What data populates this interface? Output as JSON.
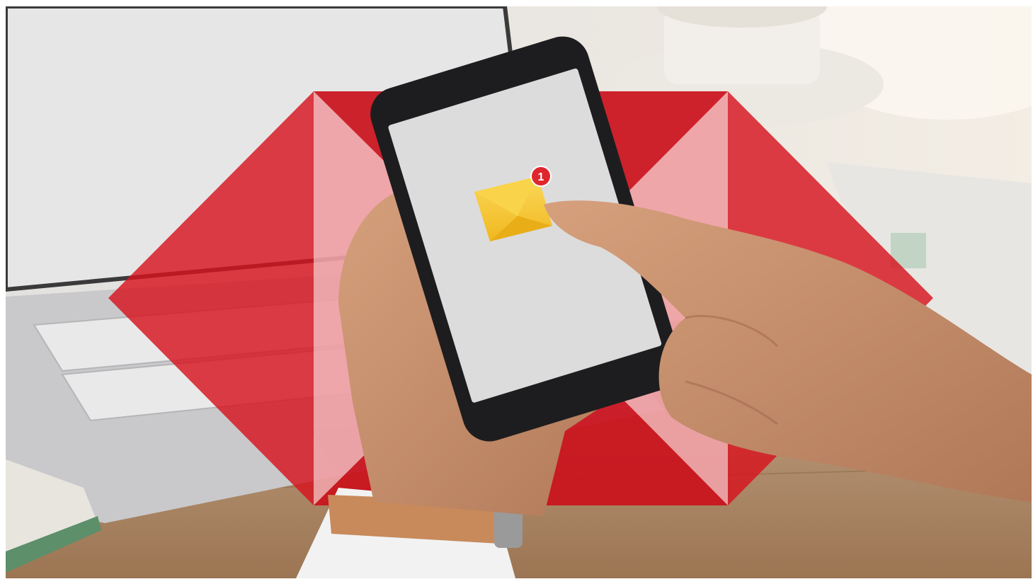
{
  "photo": {
    "notification_badge_count": "1",
    "colors": {
      "brand_red": "#d7131f",
      "envelope_yellow": "#f7c830",
      "badge_red": "#e0262d",
      "phone_screen": "#dcdcdc",
      "skin": "#c58f6e",
      "table_wood": "#a8825c"
    },
    "icons": [
      "hexagon-logo-icon",
      "envelope-icon",
      "notification-badge-icon"
    ]
  }
}
